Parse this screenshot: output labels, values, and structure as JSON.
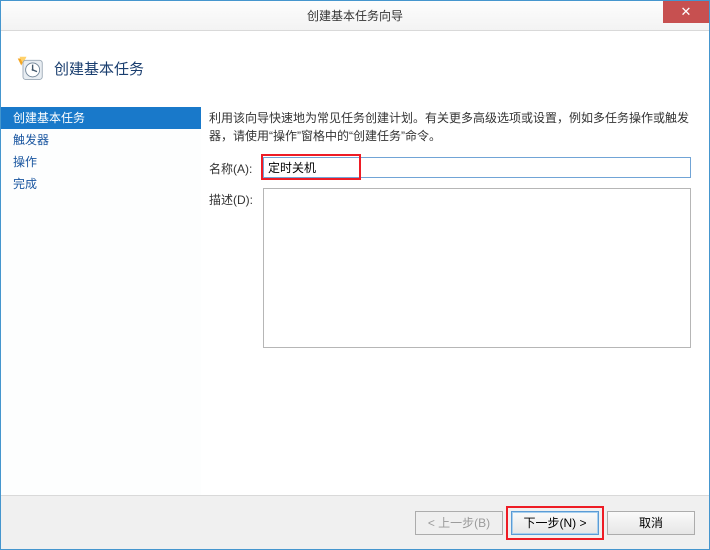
{
  "window": {
    "title": "创建基本任务向导"
  },
  "header": {
    "title": "创建基本任务"
  },
  "sidebar": {
    "items": [
      {
        "label": "创建基本任务",
        "active": true
      },
      {
        "label": "触发器",
        "active": false
      },
      {
        "label": "操作",
        "active": false
      },
      {
        "label": "完成",
        "active": false
      }
    ]
  },
  "content": {
    "intro": "利用该向导快速地为常见任务创建计划。有关更多高级选项或设置，例如多任务操作或触发器，请使用“操作”窗格中的“创建任务”命令。",
    "name_label": "名称(A):",
    "name_value": "定时关机",
    "desc_label": "描述(D):",
    "desc_value": ""
  },
  "footer": {
    "back": "< 上一步(B)",
    "next": "下一步(N) >",
    "cancel": "取消"
  },
  "annotations": {
    "highlight_name": true,
    "highlight_next": true
  }
}
